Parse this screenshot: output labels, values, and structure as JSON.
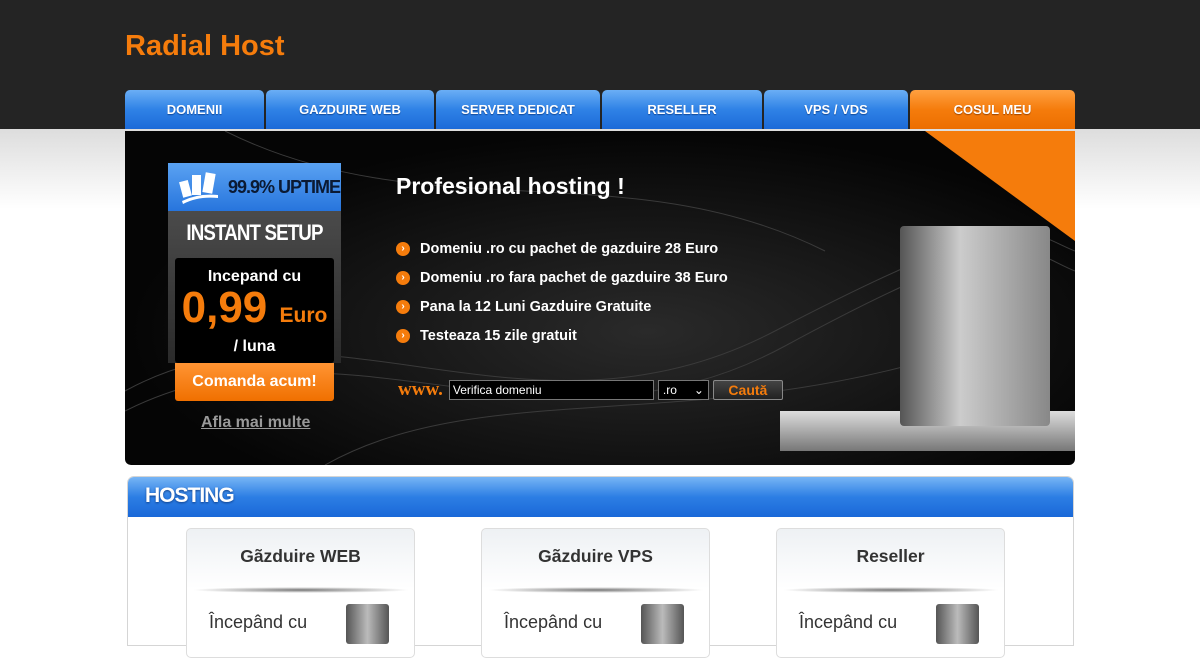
{
  "brand": "Radial Host",
  "nav": [
    {
      "label": "DOMENII"
    },
    {
      "label": "GAZDUIRE WEB"
    },
    {
      "label": "SERVER DEDICAT"
    },
    {
      "label": "RESELLER"
    },
    {
      "label": "VPS / VDS"
    },
    {
      "label": "COSUL MEU"
    }
  ],
  "promo": {
    "uptime": "99.9% UPTIME",
    "setup": "INSTANT SETUP",
    "from": "Incepand cu",
    "price": "0,99",
    "currency": "Euro",
    "period": "/ luna",
    "order": "Comanda acum!",
    "more": "Afla mai multe"
  },
  "banner": {
    "title": "Profesional hosting !",
    "features": [
      "Domeniu .ro cu pachet de gazduire 28 Euro",
      "Domeniu .ro fara pachet de gazduire 38 Euro",
      "Pana la 12 Luni Gazduire Gratuite",
      "Testeaza 15 zile gratuit"
    ]
  },
  "search": {
    "prefix": "www.",
    "value": "Verifica domeniu",
    "tld": ".ro",
    "button": "Caută"
  },
  "hosting": {
    "title": "HOSTING",
    "cards": [
      {
        "title": "Gãzduire WEB",
        "from": "Începând cu"
      },
      {
        "title": "Gãzduire VPS",
        "from": "Începând cu"
      },
      {
        "title": "Reseller",
        "from": "Începând cu"
      }
    ]
  },
  "colors": {
    "accent": "#f57c0c",
    "nav_blue": "#2f82e6",
    "header_bg": "#242424"
  }
}
